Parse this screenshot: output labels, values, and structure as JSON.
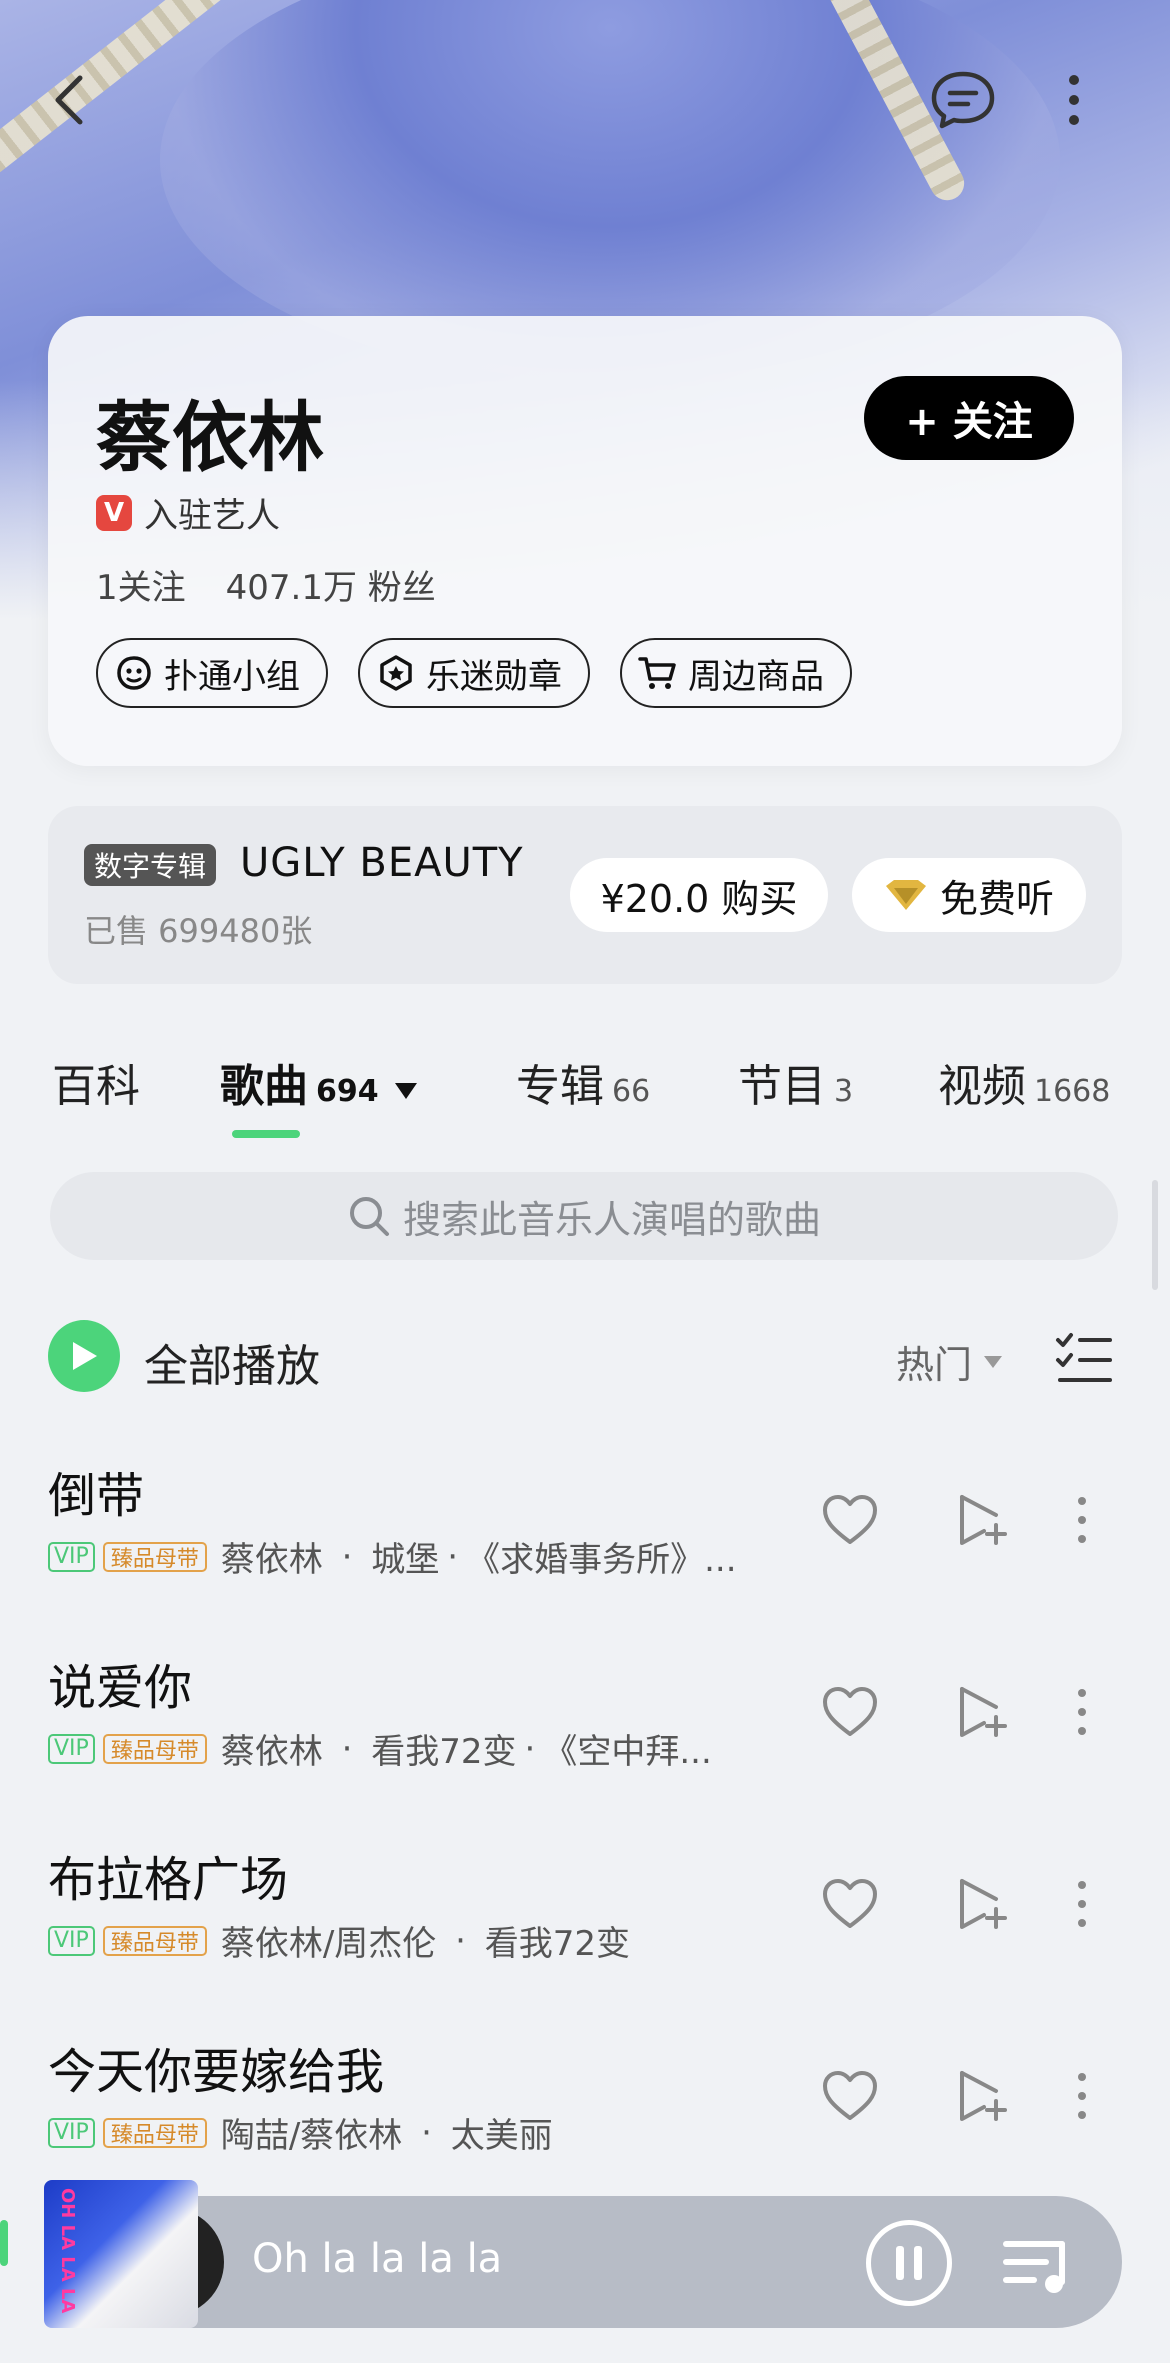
{
  "artist": {
    "name": "蔡依林",
    "follow_label": "+ 关注",
    "verified_label": "入驻艺人",
    "verified_badge": "V",
    "following": "1关注",
    "fans": "407.1万 粉丝"
  },
  "pills": [
    {
      "label": "扑通小组",
      "icon": "group-icon"
    },
    {
      "label": "乐迷勋章",
      "icon": "medal-icon"
    },
    {
      "label": "周边商品",
      "icon": "cart-icon"
    }
  ],
  "album": {
    "tag": "数字专辑",
    "name": "UGLY BEAUTY",
    "sold": "已售 699480张",
    "buy_label": "¥20.0 购买",
    "free_label": "免费听"
  },
  "tabs": [
    {
      "label": "百科",
      "count": ""
    },
    {
      "label": "歌曲",
      "count": "694"
    },
    {
      "label": "专辑",
      "count": "66"
    },
    {
      "label": "节目",
      "count": "3"
    },
    {
      "label": "视频",
      "count": "1668"
    }
  ],
  "search": {
    "placeholder": "搜索此音乐人演唱的歌曲"
  },
  "play_all": {
    "label": "全部播放",
    "sort_label": "热门"
  },
  "songs": [
    {
      "title": "倒带",
      "vip": "VIP",
      "quality": "臻品母带",
      "artists": "蔡依林",
      "album": "城堡",
      "extra": "《求婚事务所》..."
    },
    {
      "title": "说爱你",
      "vip": "VIP",
      "quality": "臻品母带",
      "artists": "蔡依林",
      "album": "看我72变",
      "extra": "《空中拜..."
    },
    {
      "title": "布拉格广场",
      "vip": "VIP",
      "quality": "臻品母带",
      "artists": "蔡依林/周杰伦",
      "album": "看我72变",
      "extra": ""
    },
    {
      "title": "今天你要嫁给我",
      "vip": "VIP",
      "quality": "臻品母带",
      "artists": "陶喆/蔡依林",
      "album": "太美丽",
      "extra": ""
    }
  ],
  "player": {
    "now_playing": "Oh la la la la",
    "cover_text": "OH LA LA LA"
  },
  "colors": {
    "accent": "#4cd47b",
    "vip": "#4cc878",
    "quality": "#d68a2a",
    "verified": "#e5473f"
  }
}
